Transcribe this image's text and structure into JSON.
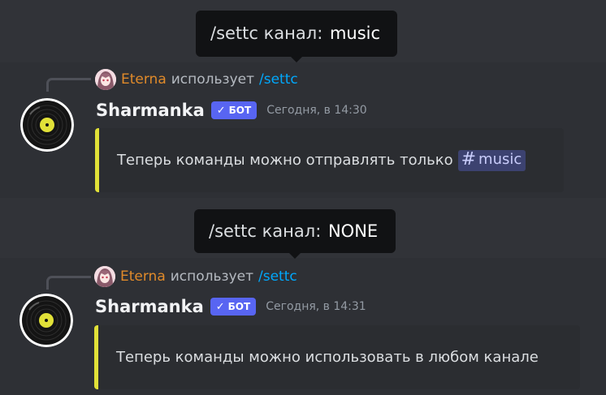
{
  "colors": {
    "background": "#313338",
    "tooltip_bg": "#111214",
    "embed_accent": "#e1e138",
    "bot_badge": "#5865f2",
    "command_link": "#00a8fc",
    "reply_username": "#e08a2a",
    "mention_bg": "#3c4270"
  },
  "tooltip1": {
    "prefix": "/settc канал:",
    "value": "music"
  },
  "tooltip2": {
    "prefix": "/settc канал:",
    "value": "NONE"
  },
  "messages": [
    {
      "reply": {
        "user": "Eterna",
        "action": "использует",
        "command": "/settc"
      },
      "author": "Sharmanka",
      "badge": "БОТ",
      "timestamp": "Сегодня, в 14:30",
      "embed_text": "Теперь команды можно отправлять только",
      "channel_mention": "music"
    },
    {
      "reply": {
        "user": "Eterna",
        "action": "использует",
        "command": "/settc"
      },
      "author": "Sharmanka",
      "badge": "БОТ",
      "timestamp": "Сегодня, в 14:31",
      "embed_text": "Теперь команды можно использовать в любом канале"
    }
  ],
  "icons": [
    "vinyl-record-avatar",
    "anime-user-avatar",
    "checkmark-icon",
    "hash-channel-icon"
  ]
}
